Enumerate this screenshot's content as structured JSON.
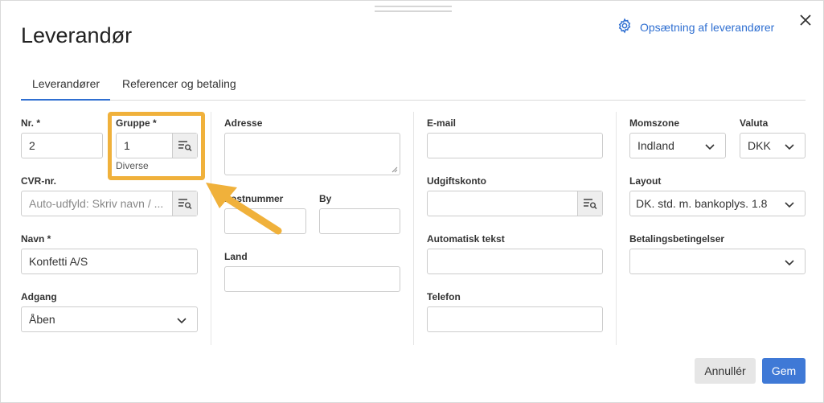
{
  "dialog": {
    "title": "Leverandør",
    "setup_link": "Opsætning af leverandører"
  },
  "tabs": [
    {
      "label": "Leverandører",
      "active": true
    },
    {
      "label": "Referencer og betaling",
      "active": false
    }
  ],
  "fields": {
    "nr": {
      "label": "Nr. *",
      "value": "2"
    },
    "gruppe": {
      "label": "Gruppe *",
      "value": "1",
      "sublabel": "Diverse"
    },
    "cvr": {
      "label": "CVR-nr.",
      "placeholder": "Auto-udfyld: Skriv navn / ..."
    },
    "navn": {
      "label": "Navn *",
      "value": "Konfetti A/S"
    },
    "adgang": {
      "label": "Adgang",
      "value": "Åben"
    },
    "adresse": {
      "label": "Adresse",
      "value": ""
    },
    "postnummer": {
      "label": "Postnummer",
      "value": ""
    },
    "by": {
      "label": "By",
      "value": ""
    },
    "land": {
      "label": "Land",
      "value": ""
    },
    "email": {
      "label": "E-mail",
      "value": ""
    },
    "udgiftskonto": {
      "label": "Udgiftskonto",
      "value": ""
    },
    "automatisk_tekst": {
      "label": "Automatisk tekst",
      "value": ""
    },
    "telefon": {
      "label": "Telefon",
      "value": ""
    },
    "momszone": {
      "label": "Momszone",
      "value": "Indland"
    },
    "valuta": {
      "label": "Valuta",
      "value": "DKK"
    },
    "layout": {
      "label": "Layout",
      "value": "DK. std. m. bankoplys. 1.8"
    },
    "betalingsbetingelser": {
      "label": "Betalingsbetingelser",
      "value": ""
    }
  },
  "buttons": {
    "cancel": "Annullér",
    "save": "Gem"
  },
  "colors": {
    "accent": "#2f6fd1",
    "highlight": "#f0b13b",
    "primary_button": "#3f79d6"
  },
  "icons": [
    "gear-icon",
    "close-icon",
    "lookup-list-icon",
    "chevron-down-icon"
  ]
}
